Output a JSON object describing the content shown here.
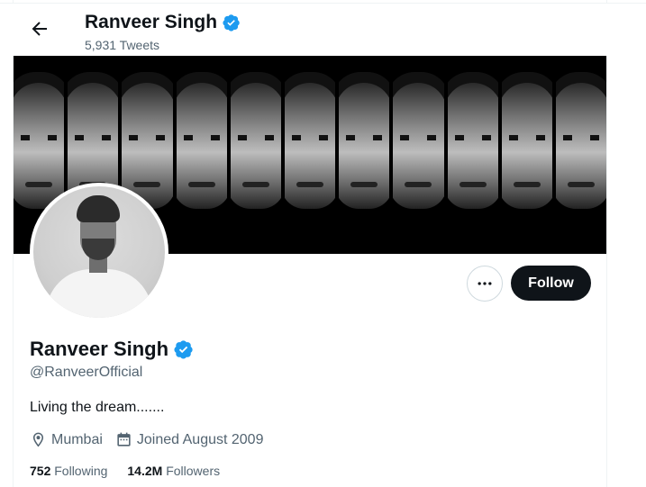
{
  "header": {
    "name": "Ranveer Singh",
    "tweet_count": "5,931 Tweets"
  },
  "profile": {
    "name": "Ranveer Singh",
    "handle": "@RanveerOfficial",
    "bio": "Living the dream.......",
    "location": "Mumbai",
    "joined": "Joined August 2009",
    "following_count": "752",
    "following_label": "Following",
    "followers_count": "14.2M",
    "followers_label": "Followers"
  },
  "actions": {
    "follow_label": "Follow",
    "more_icon": "more-horizontal-icon"
  },
  "icons": {
    "back": "arrow-left-icon",
    "verified": "verified-badge-icon",
    "location": "location-pin-icon",
    "calendar": "calendar-icon"
  },
  "colors": {
    "verified_blue": "#1d9bf0",
    "follow_bg": "#0f1419",
    "secondary_text": "#536471"
  }
}
